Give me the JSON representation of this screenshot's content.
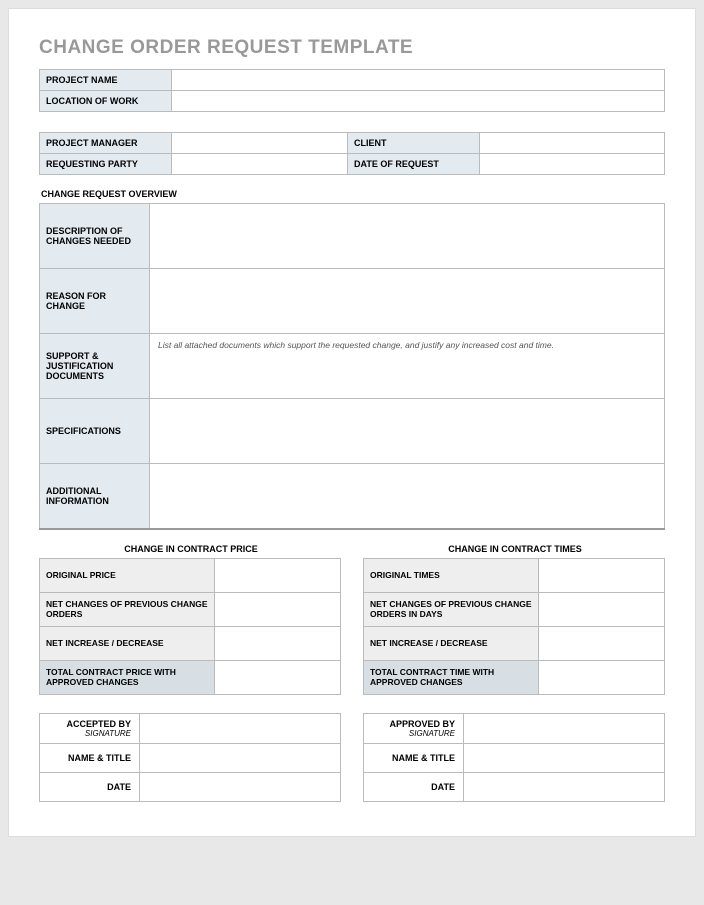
{
  "title": "CHANGE ORDER REQUEST TEMPLATE",
  "meta": {
    "project_name_label": "PROJECT NAME",
    "project_name": "",
    "location_label": "LOCATION OF WORK",
    "location": "",
    "pm_label": "PROJECT MANAGER",
    "pm": "",
    "client_label": "CLIENT",
    "client": "",
    "requesting_label": "REQUESTING PARTY",
    "requesting": "",
    "date_label": "DATE OF REQUEST",
    "date": ""
  },
  "overview": {
    "section_title": "CHANGE REQUEST OVERVIEW",
    "rows": [
      {
        "label": "DESCRIPTION OF CHANGES NEEDED",
        "value": ""
      },
      {
        "label": "REASON FOR CHANGE",
        "value": ""
      },
      {
        "label": "SUPPORT & JUSTIFICATION DOCUMENTS",
        "value": "List all attached documents which support the requested change, and justify any increased cost and time."
      },
      {
        "label": "SPECIFICATIONS",
        "value": ""
      },
      {
        "label": "ADDITIONAL INFORMATION",
        "value": ""
      }
    ]
  },
  "price": {
    "title": "CHANGE IN CONTRACT PRICE",
    "rows": [
      {
        "label": "ORIGINAL PRICE",
        "value": "",
        "total": false
      },
      {
        "label": "NET CHANGES OF PREVIOUS CHANGE ORDERS",
        "value": "",
        "total": false
      },
      {
        "label": "NET INCREASE / DECREASE",
        "value": "",
        "total": false
      },
      {
        "label": "TOTAL CONTRACT PRICE WITH APPROVED CHANGES",
        "value": "",
        "total": true
      }
    ]
  },
  "times": {
    "title": "CHANGE IN CONTRACT TIMES",
    "rows": [
      {
        "label": "ORIGINAL TIMES",
        "value": "",
        "total": false
      },
      {
        "label": "NET CHANGES OF PREVIOUS CHANGE ORDERS IN DAYS",
        "value": "",
        "total": false
      },
      {
        "label": "NET INCREASE / DECREASE",
        "value": "",
        "total": false
      },
      {
        "label": "TOTAL CONTRACT TIME WITH APPROVED CHANGES",
        "value": "",
        "total": true
      }
    ]
  },
  "accepted": {
    "by_label": "ACCEPTED BY",
    "sig_sub": "SIGNATURE",
    "name_label": "NAME & TITLE",
    "date_label": "DATE",
    "sig": "",
    "name": "",
    "date": ""
  },
  "approved": {
    "by_label": "APPROVED BY",
    "sig_sub": "SIGNATURE",
    "name_label": "NAME & TITLE",
    "date_label": "DATE",
    "sig": "",
    "name": "",
    "date": ""
  }
}
